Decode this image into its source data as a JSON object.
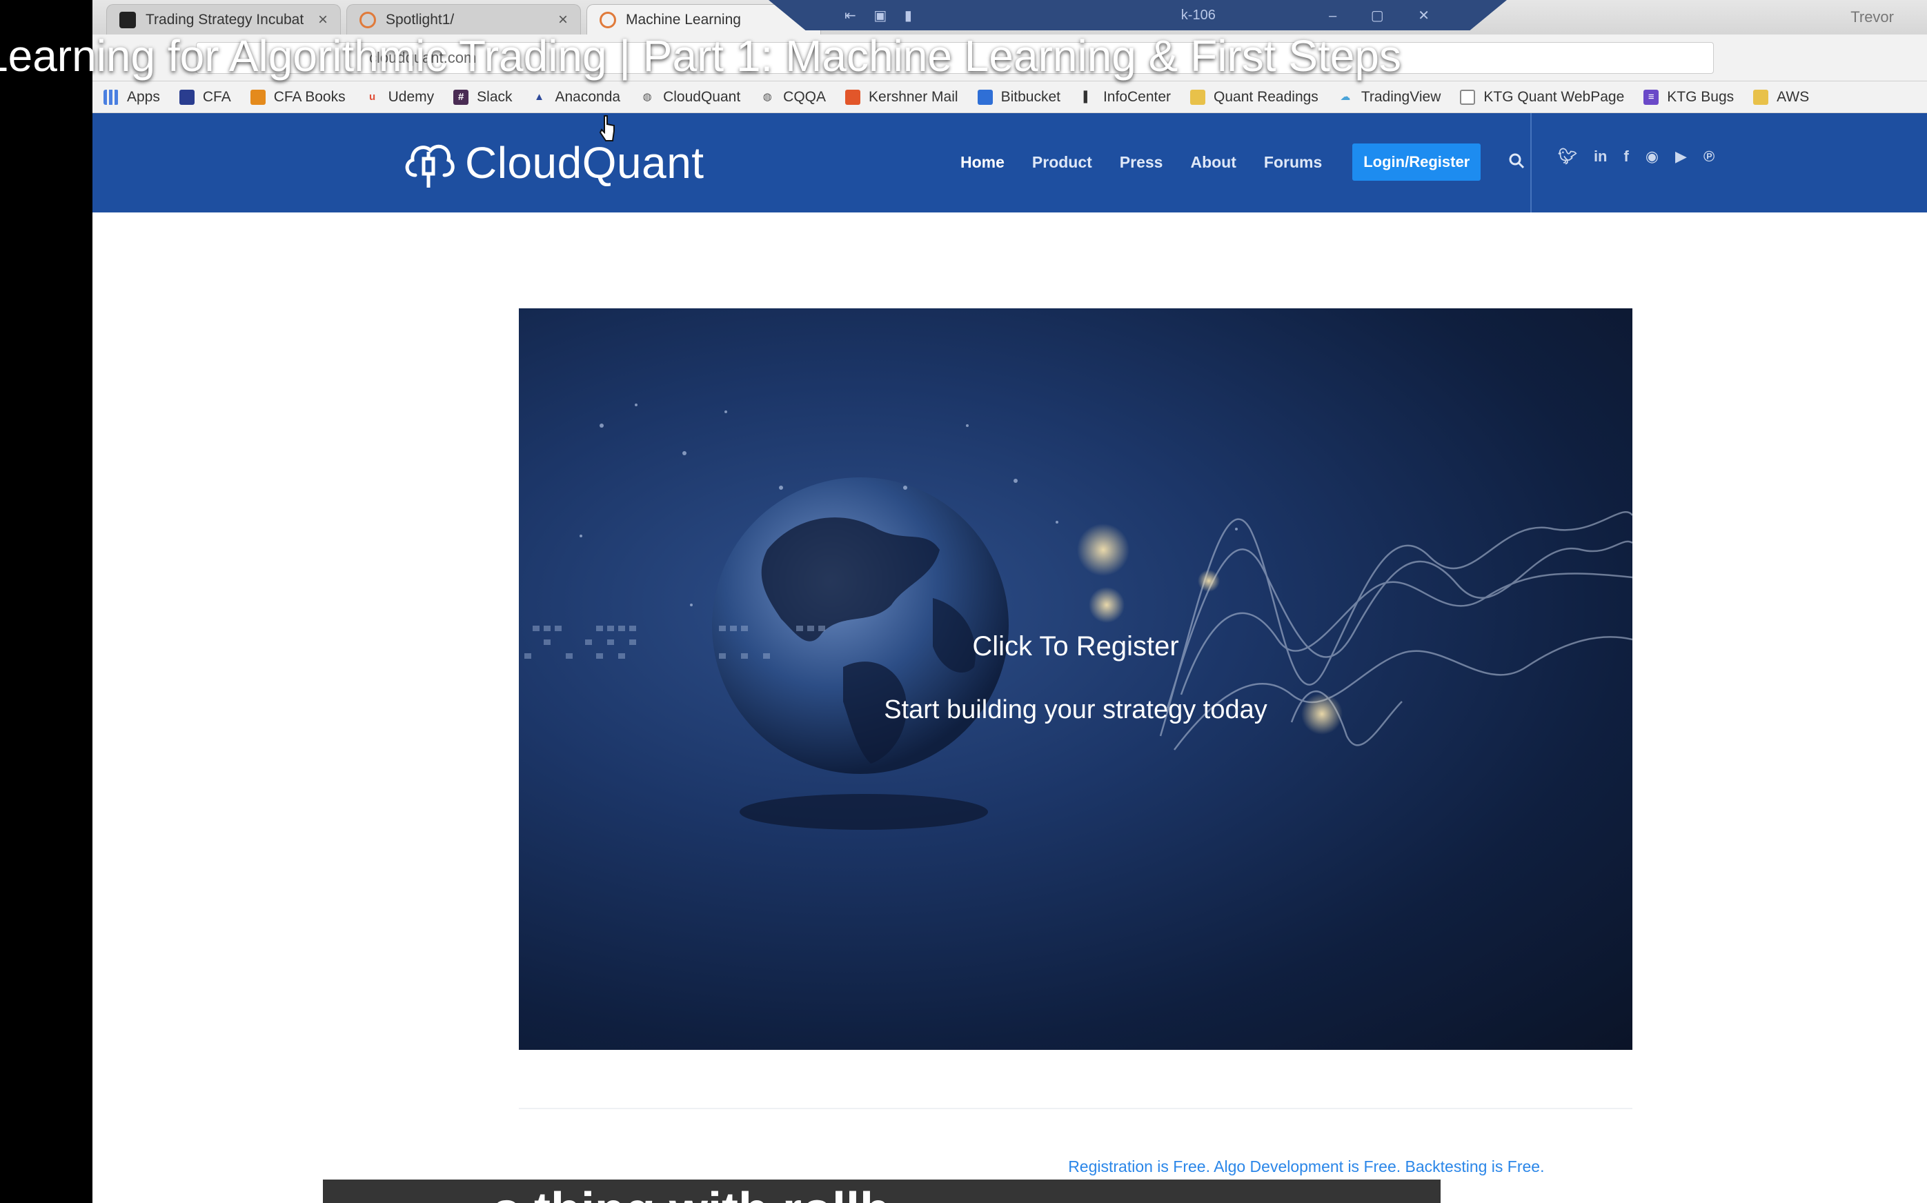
{
  "video": {
    "title": "Learning for Algorithmic Trading | Part 1: Machine Learning & First Steps",
    "caption": "s thing with rollb..."
  },
  "browser": {
    "tabs": [
      {
        "label": "Trading Strategy Incubat",
        "favicon_color": "#222222",
        "active": false
      },
      {
        "label": "Spotlight1/",
        "favicon_color": "#e07a3a",
        "active": false
      },
      {
        "label": "Machine Learning",
        "favicon_color": "#e07a3a",
        "active": true
      }
    ],
    "connection_host": "k-106",
    "user": "Trevor",
    "address": "cloudquant.com",
    "bookmarks": [
      {
        "label": "Apps",
        "icon": "apps-grid-icon",
        "color": "#4a7fe0"
      },
      {
        "label": "CFA",
        "icon": "book-icon",
        "color": "#2a3d8f"
      },
      {
        "label": "CFA Books",
        "icon": "bookmark-icon",
        "color": "#e48a1c"
      },
      {
        "label": "Udemy",
        "icon": "udemy-icon",
        "color": "#e0503a"
      },
      {
        "label": "Slack",
        "icon": "slack-icon",
        "color": "#4a2c54"
      },
      {
        "label": "Anaconda",
        "icon": "anaconda-icon",
        "color": "#2e4a9a"
      },
      {
        "label": "CloudQuant",
        "icon": "cloudquant-icon",
        "color": "#555555"
      },
      {
        "label": "CQQA",
        "icon": "cloudquant-icon",
        "color": "#555555"
      },
      {
        "label": "Kershner Mail",
        "icon": "office-icon",
        "color": "#e2562a"
      },
      {
        "label": "Bitbucket",
        "icon": "bitbucket-icon",
        "color": "#2f6fd6"
      },
      {
        "label": "InfoCenter",
        "icon": "info-icon",
        "color": "#333333"
      },
      {
        "label": "Quant Readings",
        "icon": "folder-icon",
        "color": "#e8c14a"
      },
      {
        "label": "TradingView",
        "icon": "cloud-icon",
        "color": "#49a3d8"
      },
      {
        "label": "KTG Quant WebPage",
        "icon": "page-icon",
        "color": "#888888"
      },
      {
        "label": "KTG Bugs",
        "icon": "list-icon",
        "color": "#6a49c8"
      },
      {
        "label": "AWS",
        "icon": "folder-icon",
        "color": "#e8c14a"
      }
    ]
  },
  "site": {
    "brand": "CloudQuant",
    "nav": [
      "Home",
      "Product",
      "Press",
      "About",
      "Forums"
    ],
    "login_label": "Login/Register",
    "social_icons": [
      "twitter-icon",
      "linkedin-icon",
      "facebook-icon",
      "reddit-icon",
      "youtube-icon",
      "pinterest-icon"
    ],
    "accent_color": "#1e4fa0",
    "button_color": "#1d8cf0"
  },
  "hero": {
    "title": "Click To Register",
    "subtitle": "Start building your strategy today"
  },
  "footer_text": "Registration is Free. Algo Development is Free. Backtesting is Free."
}
